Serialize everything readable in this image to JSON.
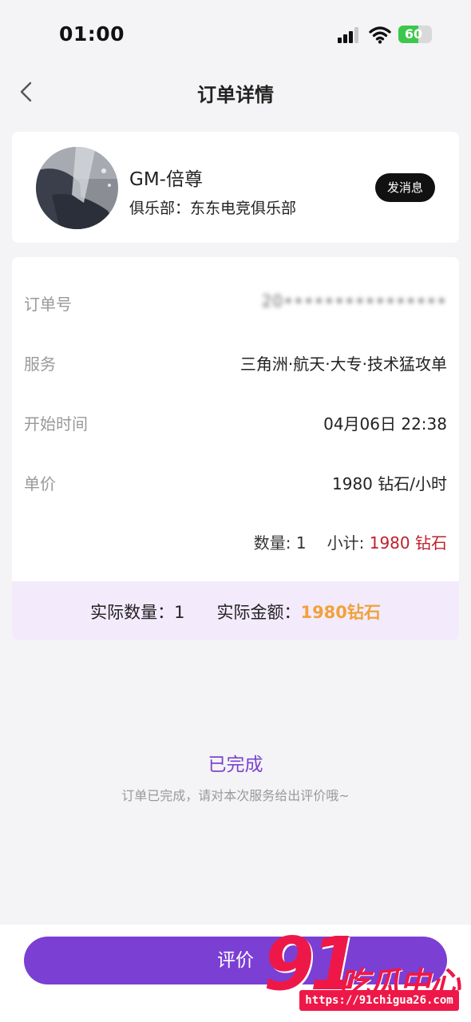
{
  "status_bar": {
    "time": "01:00",
    "battery": "60",
    "battery_level": 0.6,
    "icons": [
      "cellular-signal-icon",
      "wifi-icon",
      "battery-charging-icon"
    ]
  },
  "nav": {
    "back_icon": "chevron-left-icon",
    "title": "订单详情"
  },
  "user": {
    "name": "GM-倍尊",
    "club": "俱乐部：东东电竞俱乐部",
    "message_button": "发消息"
  },
  "order": {
    "rows": [
      {
        "label": "订单号",
        "value": "20••••••••••••••••"
      },
      {
        "label": "服务",
        "value": "三角洲·航天·大专·技术猛攻单"
      },
      {
        "label": "开始时间",
        "value": "04月06日 22:38"
      },
      {
        "label": "单价",
        "value": "1980 钻石/小时"
      }
    ],
    "quantity": "数量: 1",
    "subtotal_label": "小计:",
    "subtotal_value": "1980 钻石",
    "actual_quantity": "实际数量：1",
    "actual_amount_label": "实际金额：",
    "actual_amount_value": "1980钻石"
  },
  "status": {
    "title": "已完成",
    "description": "订单已完成，请对本次服务给出评价哦~"
  },
  "bottom": {
    "review_button": "评价"
  },
  "watermark": {
    "number": "91",
    "name": "吃瓜中心",
    "url": "https://91chigua26.com"
  },
  "colors": {
    "accent_purple": "#7b3fd4",
    "status_purple": "#7a44d0",
    "price_red": "#c0202a",
    "amount_orange": "#f0a23a",
    "actual_box_bg": "#f3ebfc",
    "watermark_red": "#ee1848"
  }
}
